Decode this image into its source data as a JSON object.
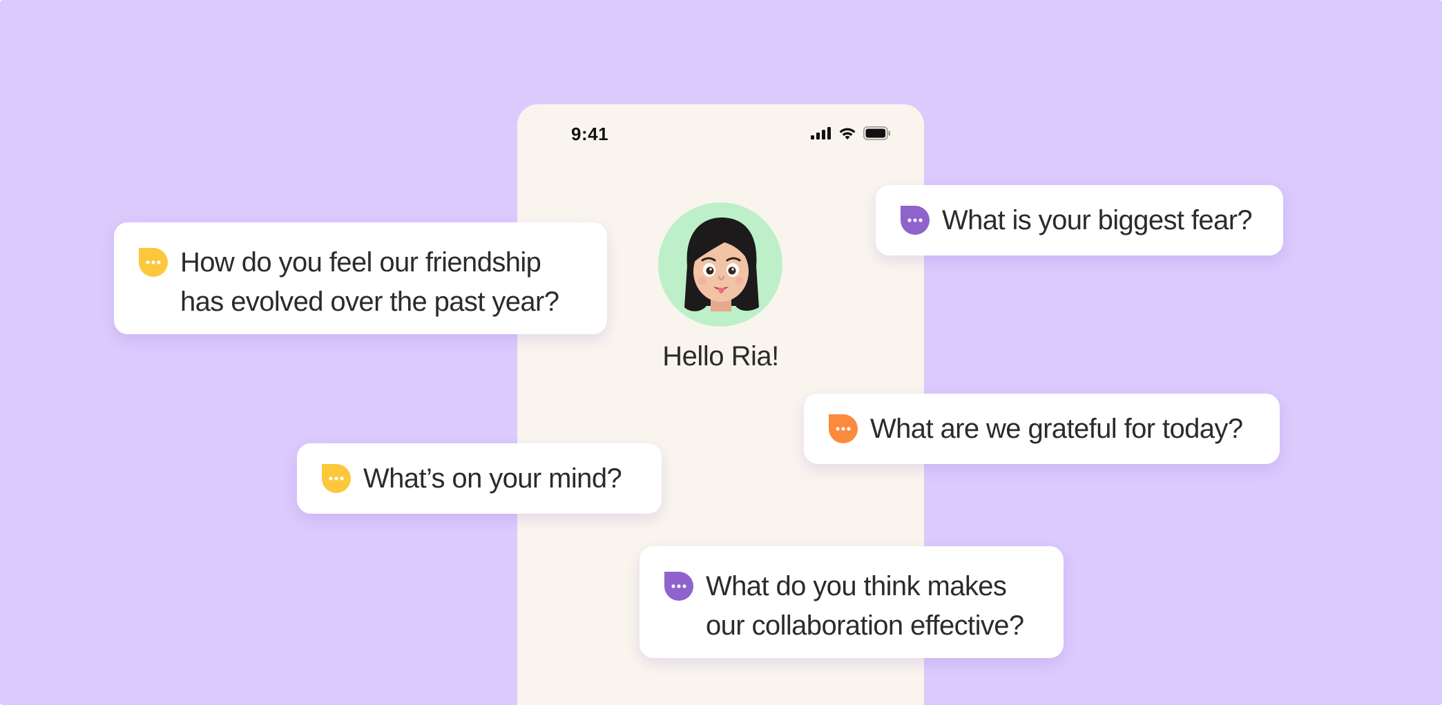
{
  "status_bar": {
    "time": "9:41",
    "icons": [
      "signal-icon",
      "wifi-icon",
      "battery-icon"
    ]
  },
  "profile": {
    "avatar": "avatar-memoji",
    "greeting": "Hello Ria!",
    "avatar_bg_color": "#bdf0c8"
  },
  "questions": [
    {
      "text": "How do you feel our friendship\nhas evolved over the past year?",
      "icon": "chat-bubble-icon",
      "icon_color": "#fcc73a"
    },
    {
      "text": "What is your biggest fear?",
      "icon": "chat-bubble-icon",
      "icon_color": "#8f62cc"
    },
    {
      "text": "What are we grateful for today?",
      "icon": "chat-bubble-icon",
      "icon_color": "#fb8a3c"
    },
    {
      "text": "What’s on your mind?",
      "icon": "chat-bubble-icon",
      "icon_color": "#fcc73a"
    },
    {
      "text": "What do you think makes\nour collaboration effective?",
      "icon": "chat-bubble-icon",
      "icon_color": "#8f62cc"
    }
  ],
  "colors": {
    "background": "#dccafd",
    "phone": "#f9f5ee",
    "card": "#ffffff",
    "text": "#2b2b2b"
  }
}
